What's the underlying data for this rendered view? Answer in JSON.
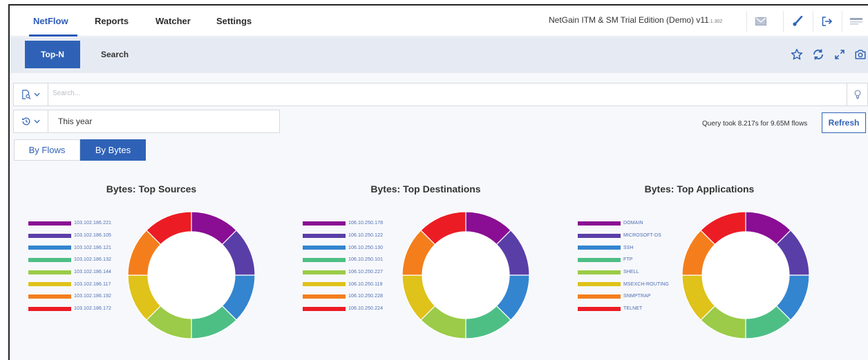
{
  "nav": {
    "items": [
      "NetFlow",
      "Reports",
      "Watcher",
      "Settings"
    ],
    "edition": "NetGain ITM & SM Trial Edition (Demo) v11",
    "version": ".1.302"
  },
  "subnav": {
    "topn": "Top-N",
    "search": "Search"
  },
  "search": {
    "placeholder": "Search..."
  },
  "time": {
    "value": "This year"
  },
  "query": {
    "status": "Query took 8.217s for 9.65M flows",
    "refresh": "Refresh"
  },
  "toggle": {
    "flows": "By Flows",
    "bytes": "By Bytes",
    "selected": "By Bytes"
  },
  "colors": {
    "accent": "#2f62b7",
    "series": [
      "#8a0e93",
      "#5a3ea8",
      "#3385cf",
      "#4dbf85",
      "#9bcb48",
      "#dfc21a",
      "#f47e1c",
      "#ec1c24"
    ]
  },
  "chart_data": [
    {
      "type": "pie",
      "title": "Bytes: Top Sources",
      "labels": [
        "103.102.186.221",
        "103.102.186.105",
        "103.102.186.121",
        "103.102.186.132",
        "103.102.186.144",
        "103.102.186.117",
        "103.102.186.192",
        "103.102.186.172"
      ],
      "values": [
        12.5,
        12.5,
        12.5,
        12.5,
        12.5,
        12.5,
        12.5,
        12.5
      ],
      "legend": "left"
    },
    {
      "type": "pie",
      "title": "Bytes: Top Destinations",
      "labels": [
        "106.10.250.178",
        "106.10.250.122",
        "106.10.250.130",
        "106.10.250.101",
        "106.10.250.227",
        "106.10.250.119",
        "106.10.250.228",
        "106.10.250.224"
      ],
      "values": [
        12.5,
        12.5,
        12.5,
        12.5,
        12.5,
        12.5,
        12.5,
        12.5
      ],
      "legend": "left"
    },
    {
      "type": "pie",
      "title": "Bytes: Top Applications",
      "labels": [
        "DOMAIN",
        "MICROSOFT-DS",
        "SSH",
        "FTP",
        "SHELL",
        "MSEXCH-ROUTING",
        "SNMPTRAP",
        "TELNET"
      ],
      "values": [
        12.5,
        12.5,
        12.5,
        12.5,
        12.5,
        12.5,
        12.5,
        12.5
      ],
      "legend": "left"
    }
  ]
}
